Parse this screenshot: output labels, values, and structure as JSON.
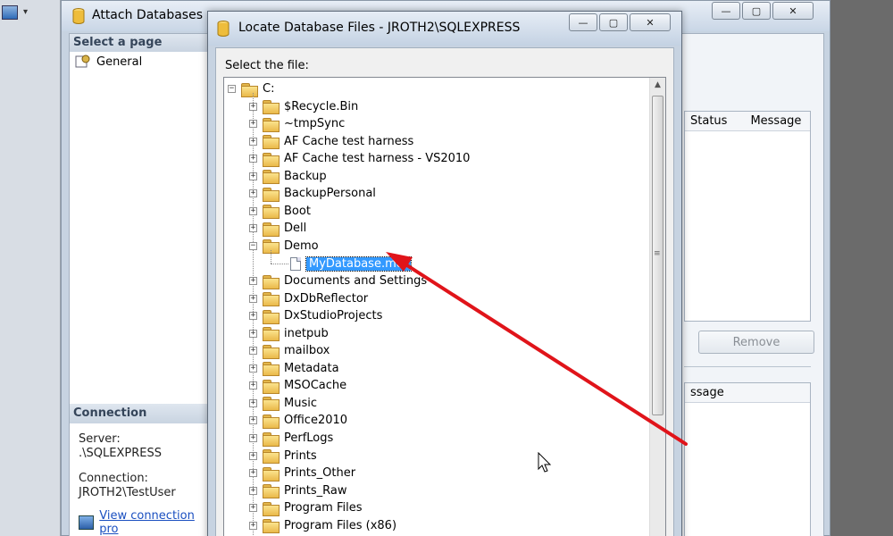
{
  "background_window": {
    "quick_access_label": "▾"
  },
  "attach_window": {
    "title": "Attach Databases",
    "window_buttons": {
      "minimize": "—",
      "maximize": "▢",
      "close": "✕"
    },
    "left_pane": {
      "select_page_header": "Select a page",
      "pages": [
        "General"
      ],
      "connection_header": "Connection",
      "server_label": "Server:",
      "server_value": ".\\SQLEXPRESS",
      "connection_label": "Connection:",
      "connection_value": "JROTH2\\TestUser",
      "view_connection_link": "View connection pro"
    },
    "right_pane": {
      "grid_headers": [
        "Status",
        "Message"
      ],
      "remove_button": "Remove",
      "details_header": "ssage"
    }
  },
  "locate_dialog": {
    "title": "Locate Database Files - JROTH2\\SQLEXPRESS",
    "window_buttons": {
      "minimize": "—",
      "maximize": "▢",
      "close": "✕"
    },
    "select_label": "Select the file:",
    "root": "C:",
    "tree_items": [
      {
        "label": "$Recycle.Bin",
        "type": "folder",
        "expanded": false
      },
      {
        "label": "~tmpSync",
        "type": "folder",
        "expanded": false
      },
      {
        "label": "AF Cache test harness",
        "type": "folder",
        "expanded": false
      },
      {
        "label": "AF Cache test harness - VS2010",
        "type": "folder",
        "expanded": false
      },
      {
        "label": "Backup",
        "type": "folder",
        "expanded": false
      },
      {
        "label": "BackupPersonal",
        "type": "folder",
        "expanded": false
      },
      {
        "label": "Boot",
        "type": "folder",
        "expanded": false
      },
      {
        "label": "Dell",
        "type": "folder",
        "expanded": false
      },
      {
        "label": "Demo",
        "type": "folder",
        "expanded": true
      },
      {
        "label": "MyDatabase.mdf",
        "type": "file",
        "selected": true
      },
      {
        "label": "Documents and Settings",
        "type": "folder",
        "expanded": false
      },
      {
        "label": "DxDbReflector",
        "type": "folder",
        "expanded": false
      },
      {
        "label": "DxStudioProjects",
        "type": "folder",
        "expanded": false
      },
      {
        "label": "inetpub",
        "type": "folder",
        "expanded": false
      },
      {
        "label": "mailbox",
        "type": "folder",
        "expanded": false
      },
      {
        "label": "Metadata",
        "type": "folder",
        "expanded": false
      },
      {
        "label": "MSOCache",
        "type": "folder",
        "expanded": false
      },
      {
        "label": "Music",
        "type": "folder",
        "expanded": false
      },
      {
        "label": "Office2010",
        "type": "folder",
        "expanded": false
      },
      {
        "label": "PerfLogs",
        "type": "folder",
        "expanded": false
      },
      {
        "label": "Prints",
        "type": "folder",
        "expanded": false
      },
      {
        "label": "Prints_Other",
        "type": "folder",
        "expanded": false
      },
      {
        "label": "Prints_Raw",
        "type": "folder",
        "expanded": false
      },
      {
        "label": "Program Files",
        "type": "folder",
        "expanded": false
      },
      {
        "label": "Program Files (x86)",
        "type": "folder",
        "expanded": false
      }
    ],
    "scrollbar": {
      "up_arrow": "▲",
      "grip": "≡"
    }
  },
  "colors": {
    "selection": "#3399ff",
    "annotation_arrow": "#e0141a",
    "folder": "#eab94a",
    "link": "#1a4fc0"
  }
}
